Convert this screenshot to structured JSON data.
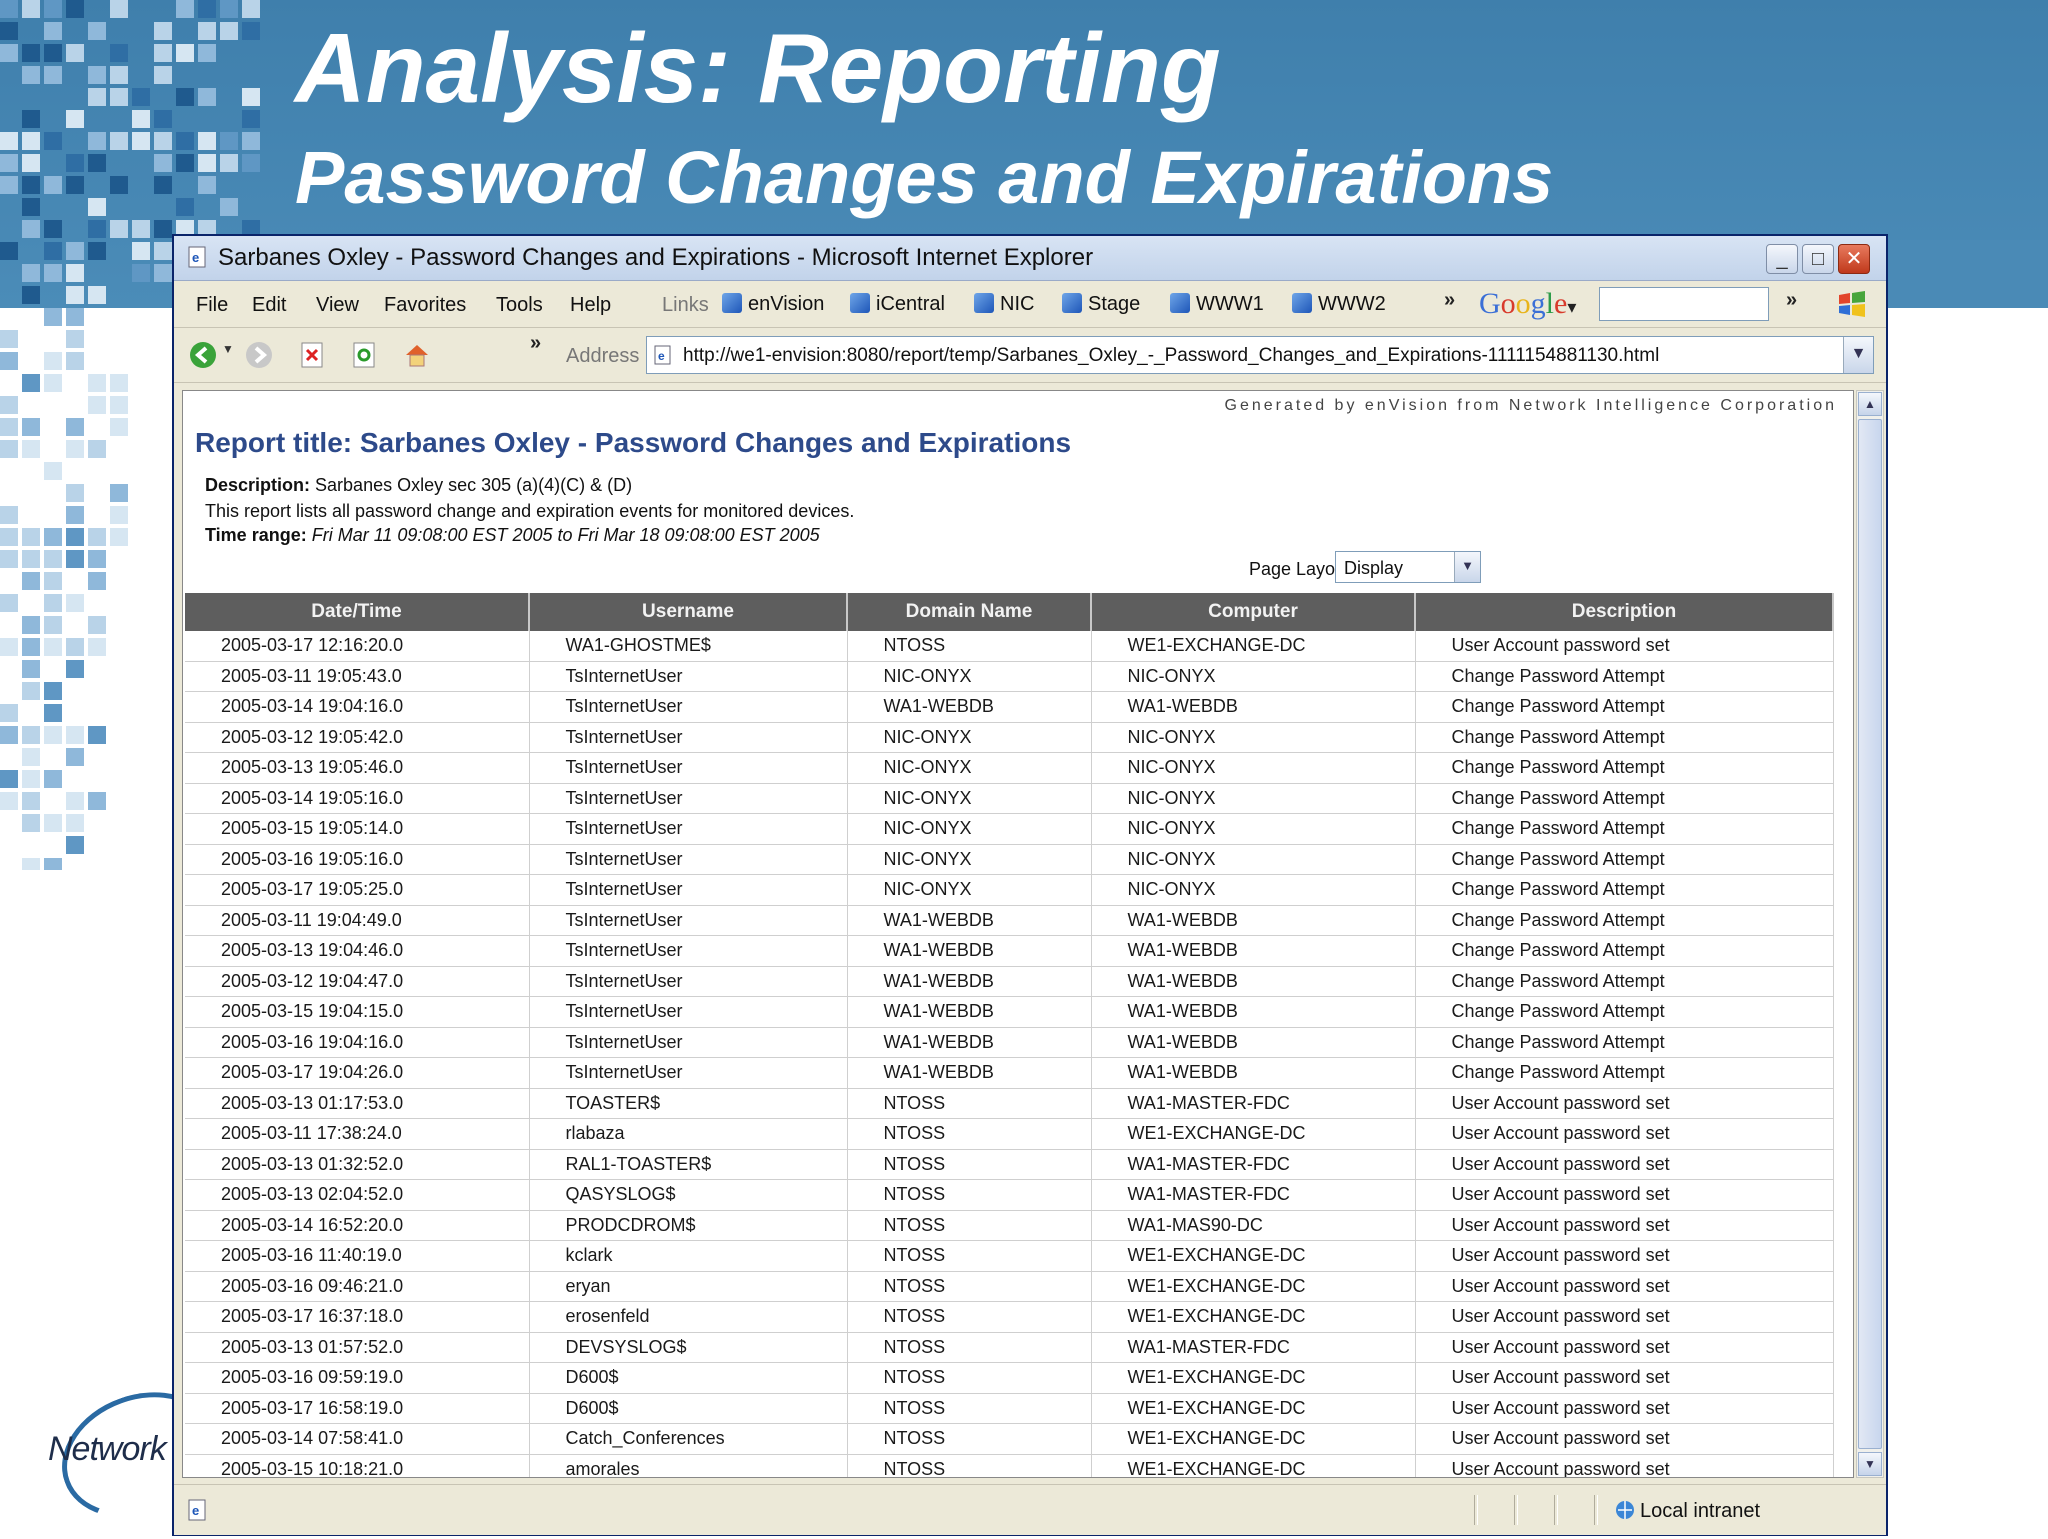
{
  "slide": {
    "title": "Analysis: Reporting",
    "subtitle": "Password Changes and Expirations",
    "logo_text": "Network"
  },
  "window": {
    "title": "Sarbanes Oxley - Password Changes and Expirations - Microsoft Internet Explorer",
    "controls": {
      "minimize": "_",
      "maximize": "□",
      "close": "✕"
    }
  },
  "menu": {
    "items": [
      "File",
      "Edit",
      "View",
      "Favorites",
      "Tools",
      "Help"
    ]
  },
  "links": {
    "label": "Links",
    "items": [
      "enVision",
      "iCentral",
      "NIC",
      "Stage",
      "WWW1",
      "WWW2"
    ],
    "more": "»"
  },
  "google": {
    "parts": [
      "G",
      "o",
      "o",
      "g",
      "l",
      "e"
    ],
    "dropdown": "▾",
    "more": "»"
  },
  "toolbar": {
    "more": "»",
    "address_label": "Address",
    "url": "http://we1-envision:8080/report/temp/Sarbanes_Oxley_-_Password_Changes_and_Expirations-1111154881130.html"
  },
  "report": {
    "generated_by": "Generated by enVision from Network Intelligence Corporation",
    "title": "Report title: Sarbanes Oxley - Password Changes and Expirations",
    "description_label": "Description:",
    "description_value": "Sarbanes Oxley sec 305 (a)(4)(C) & (D)",
    "description_line2": "This report lists all password change and expiration events for monitored devices.",
    "time_range_label": "Time range:",
    "time_range_value": "Fri Mar 11 09:08:00 EST 2005 to Fri Mar 18 09:08:00 EST 2005",
    "page_layout_label": "Page Layout",
    "page_layout_value": "Display",
    "columns": [
      "Date/Time",
      "Username",
      "Domain Name",
      "Computer",
      "Description"
    ],
    "rows": [
      [
        "2005-03-17 12:16:20.0",
        "WA1-GHOSTME$",
        "NTOSS",
        "WE1-EXCHANGE-DC",
        "User Account password set"
      ],
      [
        "2005-03-11 19:05:43.0",
        "TsInternetUser",
        "NIC-ONYX",
        "NIC-ONYX",
        "Change Password Attempt"
      ],
      [
        "2005-03-14 19:04:16.0",
        "TsInternetUser",
        "WA1-WEBDB",
        "WA1-WEBDB",
        "Change Password Attempt"
      ],
      [
        "2005-03-12 19:05:42.0",
        "TsInternetUser",
        "NIC-ONYX",
        "NIC-ONYX",
        "Change Password Attempt"
      ],
      [
        "2005-03-13 19:05:46.0",
        "TsInternetUser",
        "NIC-ONYX",
        "NIC-ONYX",
        "Change Password Attempt"
      ],
      [
        "2005-03-14 19:05:16.0",
        "TsInternetUser",
        "NIC-ONYX",
        "NIC-ONYX",
        "Change Password Attempt"
      ],
      [
        "2005-03-15 19:05:14.0",
        "TsInternetUser",
        "NIC-ONYX",
        "NIC-ONYX",
        "Change Password Attempt"
      ],
      [
        "2005-03-16 19:05:16.0",
        "TsInternetUser",
        "NIC-ONYX",
        "NIC-ONYX",
        "Change Password Attempt"
      ],
      [
        "2005-03-17 19:05:25.0",
        "TsInternetUser",
        "NIC-ONYX",
        "NIC-ONYX",
        "Change Password Attempt"
      ],
      [
        "2005-03-11 19:04:49.0",
        "TsInternetUser",
        "WA1-WEBDB",
        "WA1-WEBDB",
        "Change Password Attempt"
      ],
      [
        "2005-03-13 19:04:46.0",
        "TsInternetUser",
        "WA1-WEBDB",
        "WA1-WEBDB",
        "Change Password Attempt"
      ],
      [
        "2005-03-12 19:04:47.0",
        "TsInternetUser",
        "WA1-WEBDB",
        "WA1-WEBDB",
        "Change Password Attempt"
      ],
      [
        "2005-03-15 19:04:15.0",
        "TsInternetUser",
        "WA1-WEBDB",
        "WA1-WEBDB",
        "Change Password Attempt"
      ],
      [
        "2005-03-16 19:04:16.0",
        "TsInternetUser",
        "WA1-WEBDB",
        "WA1-WEBDB",
        "Change Password Attempt"
      ],
      [
        "2005-03-17 19:04:26.0",
        "TsInternetUser",
        "WA1-WEBDB",
        "WA1-WEBDB",
        "Change Password Attempt"
      ],
      [
        "2005-03-13 01:17:53.0",
        "TOASTER$",
        "NTOSS",
        "WA1-MASTER-FDC",
        "User Account password set"
      ],
      [
        "2005-03-11 17:38:24.0",
        "rlabaza",
        "NTOSS",
        "WE1-EXCHANGE-DC",
        "User Account password set"
      ],
      [
        "2005-03-13 01:32:52.0",
        "RAL1-TOASTER$",
        "NTOSS",
        "WA1-MASTER-FDC",
        "User Account password set"
      ],
      [
        "2005-03-13 02:04:52.0",
        "QASYSLOG$",
        "NTOSS",
        "WA1-MASTER-FDC",
        "User Account password set"
      ],
      [
        "2005-03-14 16:52:20.0",
        "PRODCDROM$",
        "NTOSS",
        "WA1-MAS90-DC",
        "User Account password set"
      ],
      [
        "2005-03-16 11:40:19.0",
        "kclark",
        "NTOSS",
        "WE1-EXCHANGE-DC",
        "User Account password set"
      ],
      [
        "2005-03-16 09:46:21.0",
        "eryan",
        "NTOSS",
        "WE1-EXCHANGE-DC",
        "User Account password set"
      ],
      [
        "2005-03-17 16:37:18.0",
        "erosenfeld",
        "NTOSS",
        "WE1-EXCHANGE-DC",
        "User Account password set"
      ],
      [
        "2005-03-13 01:57:52.0",
        "DEVSYSLOG$",
        "NTOSS",
        "WA1-MASTER-FDC",
        "User Account password set"
      ],
      [
        "2005-03-16 09:59:19.0",
        "D600$",
        "NTOSS",
        "WE1-EXCHANGE-DC",
        "User Account password set"
      ],
      [
        "2005-03-17 16:58:19.0",
        "D600$",
        "NTOSS",
        "WE1-EXCHANGE-DC",
        "User Account password set"
      ],
      [
        "2005-03-14 07:58:41.0",
        "Catch_Conferences",
        "NTOSS",
        "WE1-EXCHANGE-DC",
        "User Account password set"
      ],
      [
        "2005-03-15 10:18:21.0",
        "amorales",
        "NTOSS",
        "WE1-EXCHANGE-DC",
        "User Account password set"
      ]
    ]
  },
  "statusbar": {
    "zone": "Local intranet"
  },
  "colors": {
    "slide_blue": "#4b8cb8",
    "report_title": "#2d4a8a",
    "table_header": "#5e5e5e"
  }
}
